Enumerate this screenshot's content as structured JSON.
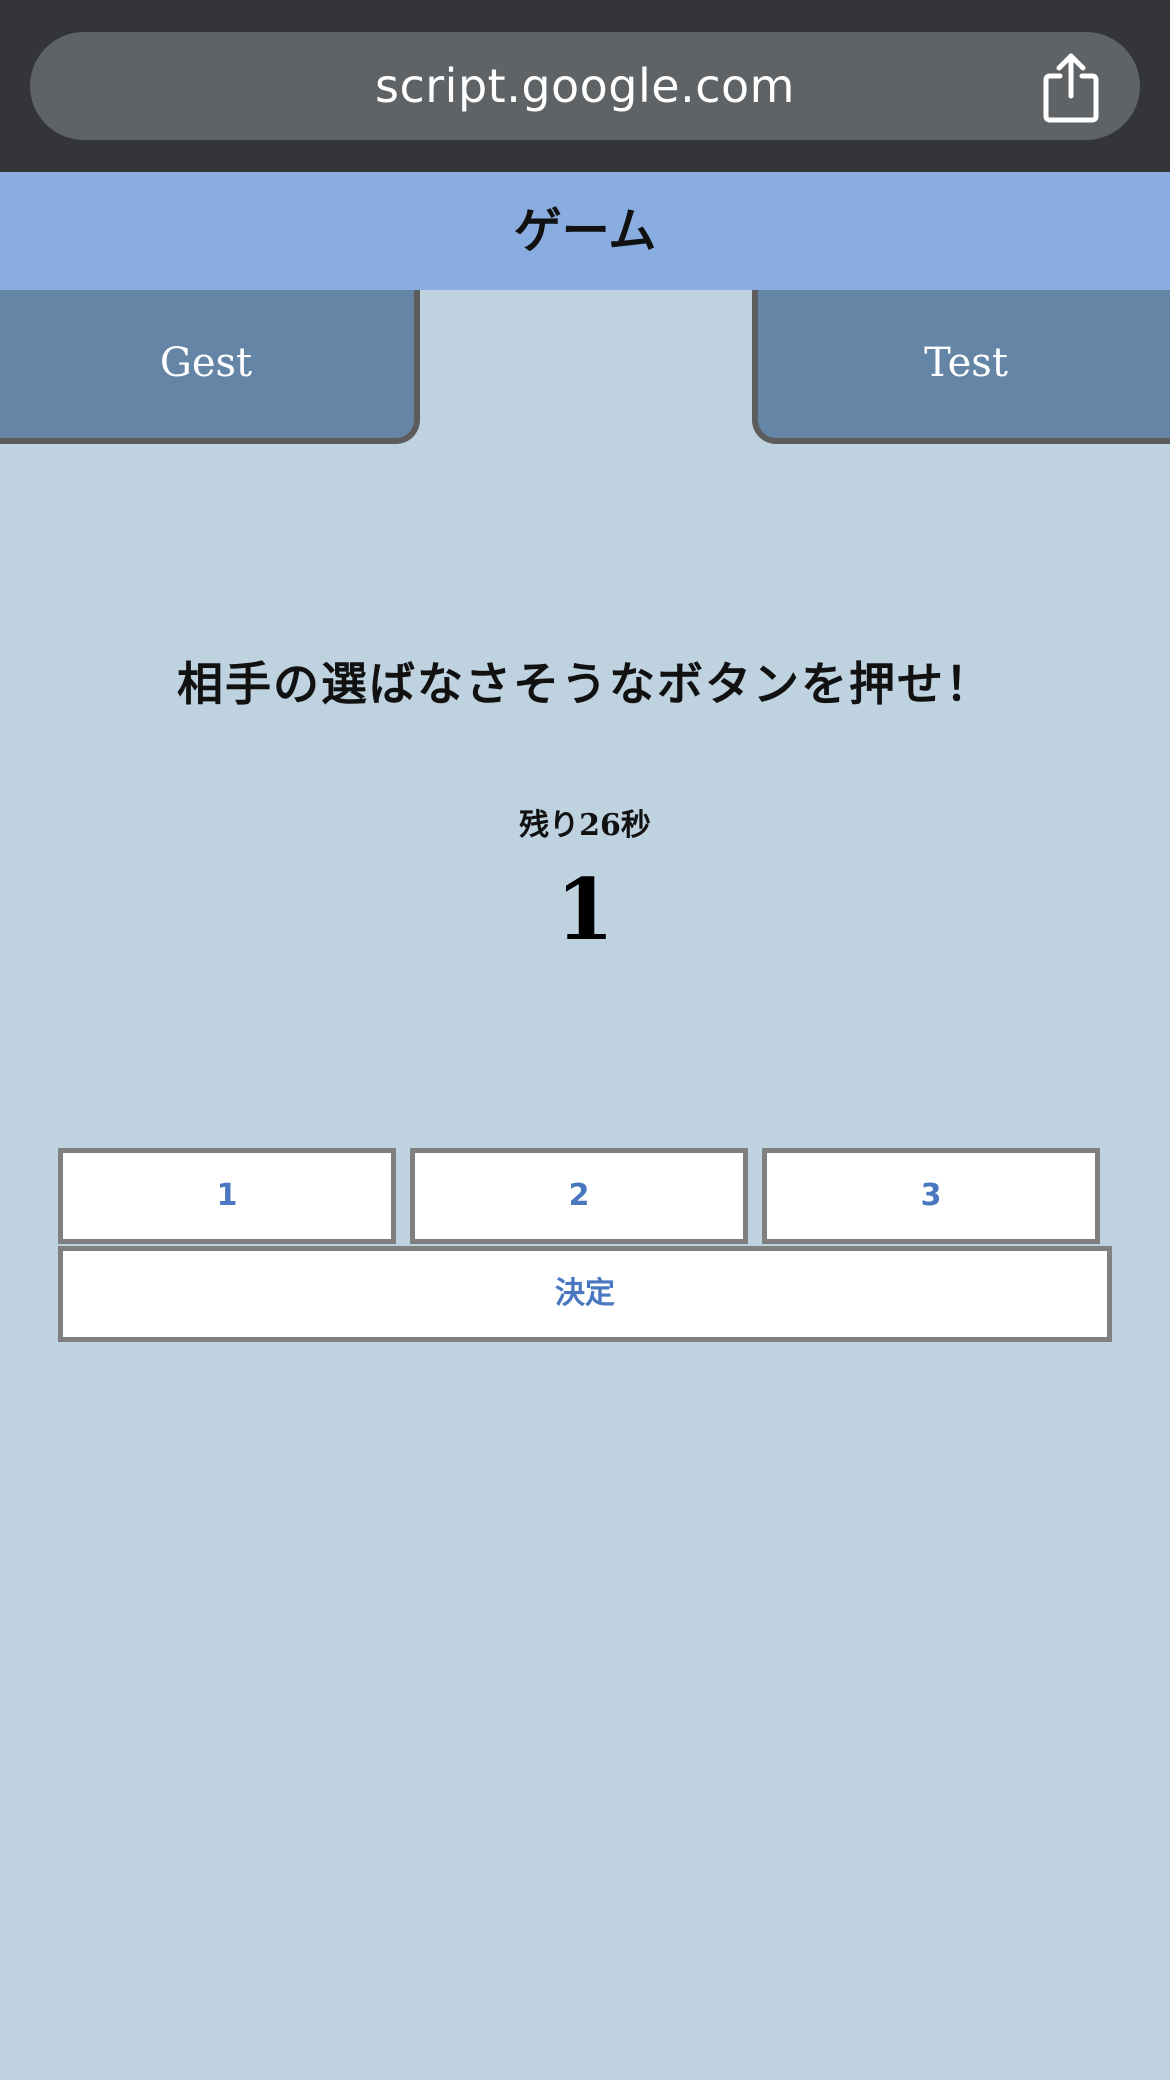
{
  "browser": {
    "url": "script.google.com",
    "share_icon": "share-icon"
  },
  "app": {
    "title": "ゲーム"
  },
  "players": {
    "left": "Gest",
    "right": "Test"
  },
  "game": {
    "prompt": "相手の選ばなさそうなボタンを押せ！",
    "timer": "残り26秒",
    "current_choice": "1"
  },
  "buttons": {
    "choices": [
      "1",
      "2",
      "3"
    ],
    "confirm": "決定"
  },
  "colors": {
    "background": "#bfd2df",
    "header": "#89ade1",
    "tab": "#6585a6",
    "button_text": "#4a78c0",
    "browser_bar": "#333538"
  }
}
